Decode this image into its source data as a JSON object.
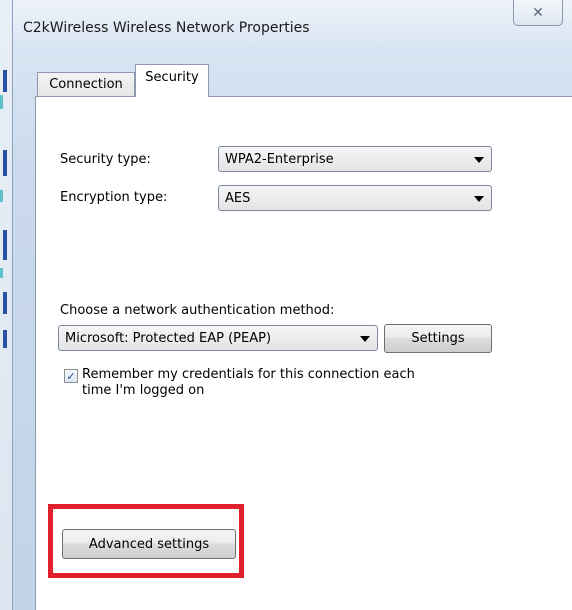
{
  "window": {
    "title": "C2kWireless Wireless Network Properties",
    "close_glyph": "✕"
  },
  "tabs": [
    {
      "label": "Connection",
      "selected": false
    },
    {
      "label": "Security",
      "selected": true
    }
  ],
  "security": {
    "security_type_label": "Security type:",
    "security_type_value": "WPA2-Enterprise",
    "encryption_type_label": "Encryption type:",
    "encryption_type_value": "AES",
    "auth_method_label": "Choose a network authentication method:",
    "auth_method_value": "Microsoft: Protected EAP (PEAP)",
    "settings_button": "Settings",
    "remember_credentials_line1": "Remember my credentials for this connection each",
    "remember_credentials_line2": "time I'm logged on",
    "remember_credentials_checked": true,
    "check_glyph": "✓",
    "advanced_settings_button": "Advanced settings"
  },
  "colors": {
    "highlight": "#e0202a"
  }
}
